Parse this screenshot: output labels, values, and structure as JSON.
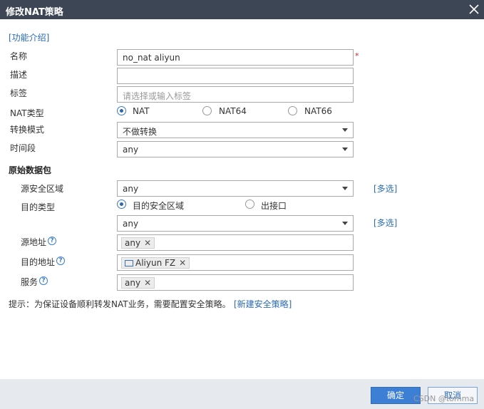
{
  "dialog": {
    "title": "修改NAT策略",
    "help_link": "[功能介绍]"
  },
  "form": {
    "name": {
      "label": "名称",
      "value": "no_nat aliyun",
      "required_mark": "*"
    },
    "description": {
      "label": "描述",
      "value": ""
    },
    "tags": {
      "label": "标签",
      "placeholder": "请选择或输入标签"
    },
    "nat_type": {
      "label": "NAT类型",
      "options": [
        "NAT",
        "NAT64",
        "NAT66"
      ],
      "selected": "NAT"
    },
    "translation_mode": {
      "label": "转换模式",
      "value": "不做转换"
    },
    "time_range": {
      "label": "时间段",
      "value": "any"
    }
  },
  "original_packet": {
    "heading": "原始数据包",
    "source_zone": {
      "label": "源安全区域",
      "value": "any",
      "multi_link": "[多选]"
    },
    "dest_type": {
      "label": "目的类型",
      "options": [
        "目的安全区域",
        "出接口"
      ],
      "selected": "目的安全区域"
    },
    "dest_zone": {
      "value": "any",
      "multi_link": "[多选]"
    },
    "source_address": {
      "label": "源地址",
      "tags": [
        "any"
      ]
    },
    "dest_address": {
      "label": "目的地址",
      "tags": [
        "Aliyun FZ"
      ]
    },
    "service": {
      "label": "服务",
      "tags": [
        "any"
      ]
    },
    "help_glyph": "?"
  },
  "hint": {
    "text": "提示：为保证设备顺利转发NAT业务，需要配置安全策略。",
    "link": "[新建安全策略]"
  },
  "footer": {
    "ok": "确定",
    "cancel": "取消",
    "watermark": "CSDN @tomma"
  }
}
